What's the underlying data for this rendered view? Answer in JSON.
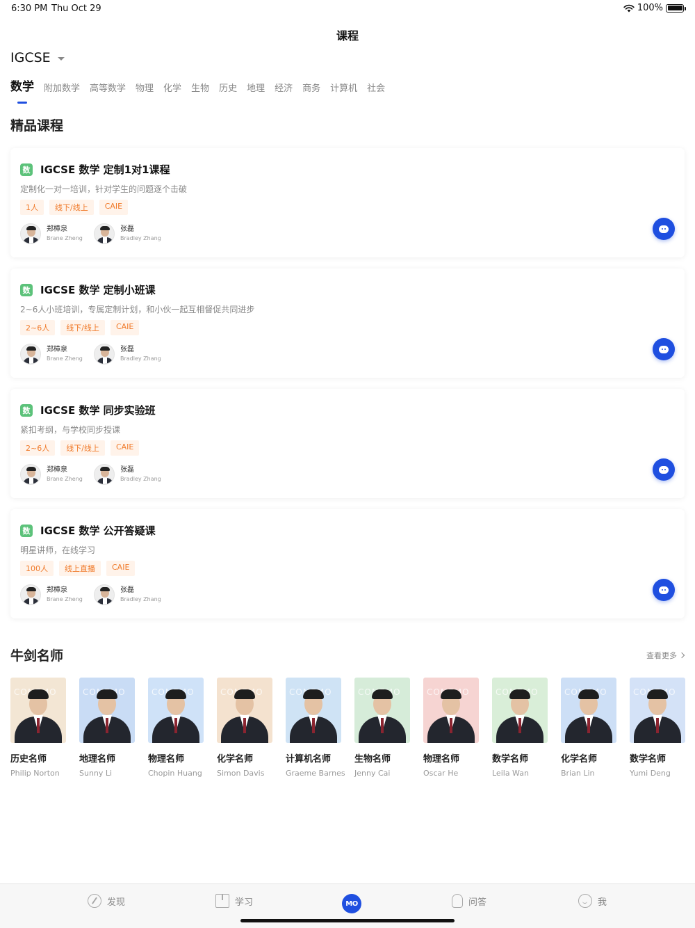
{
  "status_bar": {
    "time": "6:30 PM",
    "date": "Thu Oct 29",
    "battery": "100%"
  },
  "nav": {
    "title": "课程"
  },
  "exam_selector": {
    "value": "IGCSE"
  },
  "subject_tabs": [
    {
      "label": "数学",
      "active": true
    },
    {
      "label": "附加数学"
    },
    {
      "label": "高等数学"
    },
    {
      "label": "物理"
    },
    {
      "label": "化学"
    },
    {
      "label": "生物"
    },
    {
      "label": "历史"
    },
    {
      "label": "地理"
    },
    {
      "label": "经济"
    },
    {
      "label": "商务"
    },
    {
      "label": "计算机"
    },
    {
      "label": "社会"
    }
  ],
  "featured": {
    "title": "精品课程",
    "badge": "数",
    "courses": [
      {
        "title": "IGCSE 数学 定制1对1课程",
        "desc": "定制化一对一培训，针对学生的问题逐个击破",
        "tags": [
          "1人",
          "线下/线上",
          "CAIE"
        ],
        "teachers": [
          {
            "name": "郑樟泉",
            "en": "Brane Zheng"
          },
          {
            "name": "张磊",
            "en": "Bradley Zhang"
          }
        ]
      },
      {
        "title": "IGCSE 数学 定制小班课",
        "desc": "2~6人小班培训，专属定制计划，和小伙一起互相督促共同进步",
        "tags": [
          "2~6人",
          "线下/线上",
          "CAIE"
        ],
        "teachers": [
          {
            "name": "郑樟泉",
            "en": "Brane Zheng"
          },
          {
            "name": "张磊",
            "en": "Bradley Zhang"
          }
        ]
      },
      {
        "title": "IGCSE 数学 同步实验班",
        "desc": "紧扣考纲，与学校同步授课",
        "tags": [
          "2~6人",
          "线下/线上",
          "CAIE"
        ],
        "teachers": [
          {
            "name": "郑樟泉",
            "en": "Brane Zheng"
          },
          {
            "name": "张磊",
            "en": "Bradley Zhang"
          }
        ]
      },
      {
        "title": "IGCSE 数学 公开答疑课",
        "desc": "明星讲师，在线学习",
        "tags": [
          "100人",
          "线上直播",
          "CAIE"
        ],
        "teachers": [
          {
            "name": "郑樟泉",
            "en": "Brane Zheng"
          },
          {
            "name": "张磊",
            "en": "Bradley Zhang"
          }
        ]
      }
    ]
  },
  "teachers_section": {
    "title": "牛剑名师",
    "more_label": "查看更多",
    "watermark": "COMEMO",
    "items": [
      {
        "role": "历史名师",
        "name": "Philip Norton",
        "bg": "#f3e6d4"
      },
      {
        "role": "地理名师",
        "name": "Sunny Li",
        "bg": "#c9dcf5"
      },
      {
        "role": "物理名师",
        "name": "Chopin Huang",
        "bg": "#cfe2f8"
      },
      {
        "role": "化学名师",
        "name": "Simon Davis",
        "bg": "#f4e2cf"
      },
      {
        "role": "计算机名师",
        "name": "Graeme Barnes",
        "bg": "#cfe3f5"
      },
      {
        "role": "生物名师",
        "name": "Jenny Cai",
        "bg": "#d6ecd9"
      },
      {
        "role": "物理名师",
        "name": "Oscar He",
        "bg": "#f6d4d2"
      },
      {
        "role": "数学名师",
        "name": "Leila Wan",
        "bg": "#d9eed8"
      },
      {
        "role": "化学名师",
        "name": "Brian Lin",
        "bg": "#cddff6"
      },
      {
        "role": "数学名师",
        "name": "Yumi Deng",
        "bg": "#d4e2f7"
      }
    ]
  },
  "tab_bar": {
    "items": [
      {
        "label": "发现",
        "icon": "compass-icon"
      },
      {
        "label": "学习",
        "icon": "book-icon"
      },
      {
        "label": "MO",
        "icon": "mo-logo-icon"
      },
      {
        "label": "问答",
        "icon": "bulb-icon"
      },
      {
        "label": "我",
        "icon": "face-icon"
      }
    ]
  },
  "colors": {
    "accent": "#1f4fe0",
    "tag_text": "#f07a2a",
    "tag_bg": "#fff3ea",
    "badge": "#5cc27a"
  }
}
